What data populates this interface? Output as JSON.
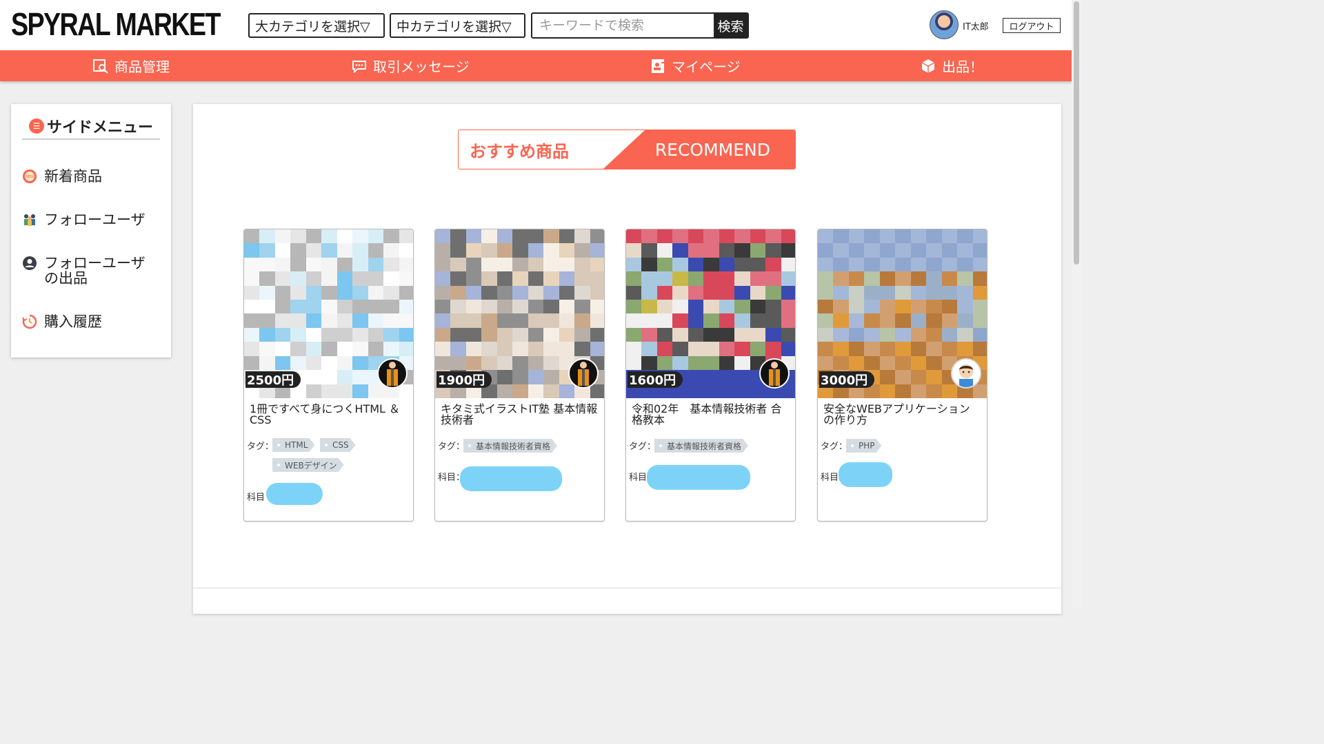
{
  "header": {
    "logo": "SPYRAL MARKET",
    "category_large": "大カテゴリを選択▽",
    "category_medium": "中カテゴリを選択▽",
    "search_placeholder": "キーワードで検索",
    "search_button": "検索",
    "user_name": "IT太郎",
    "logout": "ログアウト"
  },
  "nav": [
    {
      "label": "商品管理",
      "icon": "product-management-icon"
    },
    {
      "label": "取引メッセージ",
      "icon": "message-icon"
    },
    {
      "label": "マイページ",
      "icon": "mypage-icon"
    },
    {
      "label": "出品！",
      "icon": "box-icon"
    }
  ],
  "sidemenu": {
    "title": "サイドメニュー",
    "items": [
      {
        "label": "新着商品",
        "icon": "new-badge-icon"
      },
      {
        "label": "フォローユーザ",
        "icon": "users-icon"
      },
      {
        "label": "フォローユーザ\nの出品",
        "icon": "user-circle-icon"
      },
      {
        "label": "購入履歴",
        "icon": "history-icon"
      }
    ]
  },
  "recommend": {
    "left": "おすすめ商品",
    "right": "RECOMMEND"
  },
  "products": [
    {
      "price": "2500円",
      "title": "1冊ですべて身につくHTML ＆ CSS",
      "tag_label": "タグ：",
      "tags": [
        "HTML",
        "CSS",
        "WEBデザイン"
      ],
      "subject_label": "科目"
    },
    {
      "price": "1900円",
      "title": "キタミ式イラストIT塾 基本情報技術者",
      "tag_label": "タグ：",
      "tags": [
        "基本情報技術者資格"
      ],
      "subject_label": "科目："
    },
    {
      "price": "1600円",
      "title": "令和02年　基本情報技術者 合格教本",
      "tag_label": "タグ：",
      "tags": [
        "基本情報技術者資格"
      ],
      "subject_label": "科目"
    },
    {
      "price": "3000円",
      "title": "安全なWEBアプリケーション の作り方",
      "tag_label": "タグ：",
      "tags": [
        "PHP"
      ],
      "subject_label": "科目"
    }
  ],
  "colors": {
    "accent": "#f96550",
    "subject_blob": "#7dd3f7"
  }
}
